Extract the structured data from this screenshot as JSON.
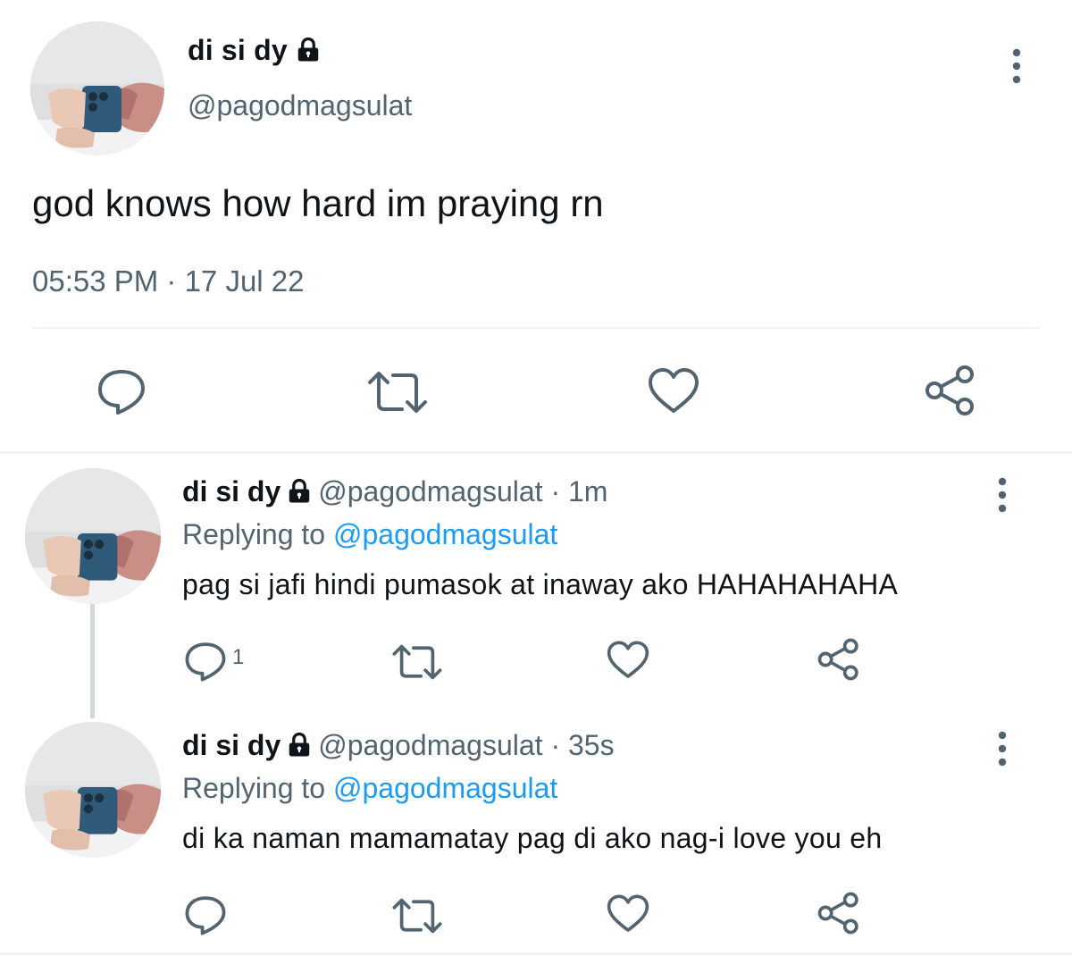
{
  "main_tweet": {
    "display_name": "di si dy",
    "handle": "@pagodmagsulat",
    "text": "god knows how hard im praying rn",
    "timestamp": "05:53 PM · 17 Jul 22",
    "locked_icon": "lock-icon",
    "actions": [
      "reply-icon",
      "retweet-icon",
      "like-icon",
      "share-icon"
    ]
  },
  "replies": [
    {
      "display_name": "di si dy",
      "handle": "@pagodmagsulat",
      "time": "· 1m",
      "replying_prefix": "Replying to",
      "replying_to": "@pagodmagsulat",
      "text": "pag si jafi hindi pumasok at inaway ako HAHAHAHAHA",
      "reply_count": "1"
    },
    {
      "display_name": "di si dy",
      "handle": "@pagodmagsulat",
      "time": "· 35s",
      "replying_prefix": "Replying to",
      "replying_to": "@pagodmagsulat",
      "text": "di ka naman mamamatay pag di ako nag-i love you eh",
      "reply_count": ""
    }
  ],
  "colors": {
    "text": "#0f1419",
    "secondary": "#536471",
    "link": "#1d9bf0",
    "icon": "#536471",
    "divider": "#eff3f4"
  }
}
